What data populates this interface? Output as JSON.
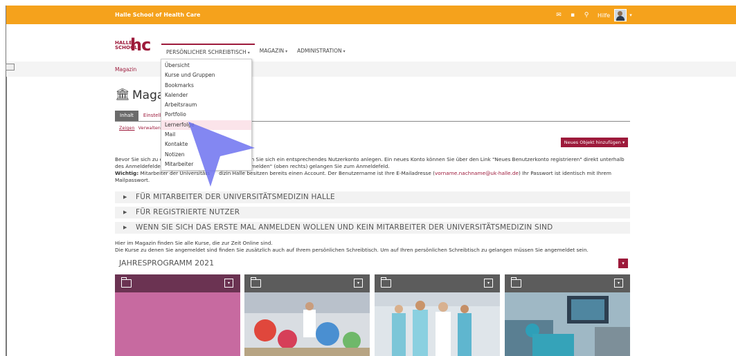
{
  "topbar": {
    "brand": "Halle School of Health Care",
    "icons": [
      "mail-icon",
      "chat-icon",
      "search-icon"
    ],
    "help_label": "Hilfe"
  },
  "logo": {
    "line1": "HALLE",
    "line2": "SCHOOL",
    "mark": "hc"
  },
  "nav": {
    "items": [
      {
        "label": "PERSÖNLICHER SCHREIBTISCH"
      },
      {
        "label": "MAGAZIN"
      },
      {
        "label": "ADMINISTRATION"
      }
    ]
  },
  "breadcrumb": "Magazin",
  "page_title": "Maga",
  "tabs": [
    {
      "label": "Inhalt"
    },
    {
      "label": "Einstell"
    }
  ],
  "subtabs": [
    {
      "label": "Zeigen"
    },
    {
      "label": "Verwalten"
    }
  ],
  "add_button": "Neues Objekt hinzufügen",
  "intro": {
    "line1_start": "Bevor Sie sich zu e",
    "line1_end": "en Sie sich ein entsprechendes Nutzerkonto anlegen. Ein neues Konto können Sie über den Link \"Neues Benutzerkonto registrieren\" direkt unterhalb",
    "line2_start": "des Anmeldefeldes",
    "line2_end": "e \"Anmelden\" (oben rechts) gelangen Sie zum Anmeldefeld.",
    "bold": "Wichtig:",
    "line3_a": " Mitarbeiter der Universitäts",
    "line3_b": "dizin Halle besitzen bereits einen Account. Der Benutzername ist Ihre E-Mailadresse (",
    "email": "vorname.nachname@uk-halle.de",
    "line3_c": ") Ihr Passwort ist identisch mit Ihrem",
    "line4": "Mailpasswort."
  },
  "accordions": [
    {
      "label": "FÜR MITARBEITER DER UNIVERSITÄTSMEDIZIN HALLE"
    },
    {
      "label": "FÜR REGISTRIERTE NUTZER"
    },
    {
      "label": "WENN SIE SICH DAS ERSTE MAL ANMELDEN WOLLEN UND KEIN MITARBEITER DER UNIVERSITÄTSMEDIZIN SIND"
    }
  ],
  "info": {
    "line1": "Hier im Magazin finden Sie alle Kurse, die zur Zeit Online sind.",
    "line2": "Die Kurse zu denen Sie angemeldet sind finden Sie zusätzlich auch auf Ihrem persönlichen Schreibtisch. Um auf Ihren persönlichen Schreibtisch zu gelangen müssen Sie angemeldet sein."
  },
  "year_section": "JAHRESPROGRAMM 2021",
  "dropdown_menu": [
    "Übersicht",
    "Kurse und Gruppen",
    "Bookmarks",
    "Kalender",
    "Arbeitsraum",
    "Portfolio",
    "Lernerfolge",
    "Mail",
    "Kontakte",
    "Notizen",
    "Mitarbeiter"
  ],
  "highlighted_menu_item": "Lernerfolge",
  "colors": {
    "topbar": "#f5a21c",
    "accent": "#9d1a3b",
    "tile1_bar": "#6b3352",
    "tile1_body": "#c76aa0"
  }
}
